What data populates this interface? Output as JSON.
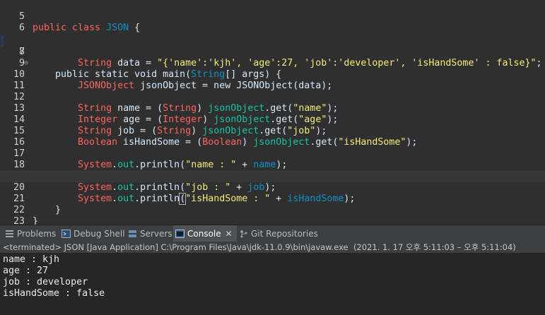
{
  "editor": {
    "lines": [
      {
        "n": "5",
        "text": "public class JSON {"
      },
      {
        "n": "6",
        "text": ""
      },
      {
        "n": "7",
        "text": "    public static void main(String[] args) {"
      },
      {
        "n": "8",
        "text": "        String data = \"{'name':'kjh', 'age':27, 'job':'developer', 'isHandSome' : false}\";"
      },
      {
        "n": "9",
        "text": ""
      },
      {
        "n": "10",
        "text": "        JSONObject jsonObject = new JSONObject(data);"
      },
      {
        "n": "11",
        "text": ""
      },
      {
        "n": "12",
        "text": "        String name = (String) jsonObject.get(\"name\");"
      },
      {
        "n": "13",
        "text": "        Integer age = (Integer) jsonObject.get(\"age\");"
      },
      {
        "n": "14",
        "text": "        String job = (String) jsonObject.get(\"job\");"
      },
      {
        "n": "15",
        "text": "        Boolean isHandSome = (Boolean) jsonObject.get(\"isHandSome\");"
      },
      {
        "n": "16",
        "text": ""
      },
      {
        "n": "17",
        "text": "        System.out.println(\"name : \" + name);"
      },
      {
        "n": "18",
        "text": "        System.out.println(\"age : \" + age);"
      },
      {
        "n": "19",
        "text": "        System.out.println(\"job : \" + job);"
      },
      {
        "n": "20",
        "text": "        System.out.println(\"isHandSome : \" + isHandSome);"
      },
      {
        "n": "21",
        "text": "    }"
      },
      {
        "n": "22",
        "text": "}"
      },
      {
        "n": "23",
        "text": ""
      }
    ],
    "active_line": "20"
  },
  "tabs": [
    {
      "label": "Problems",
      "icon": "problems-icon"
    },
    {
      "label": "Debug Shell",
      "icon": "debug-shell-icon"
    },
    {
      "label": "Servers",
      "icon": "servers-icon"
    },
    {
      "label": "Console",
      "icon": "console-icon",
      "close": "✕"
    },
    {
      "label": "Git Repositories",
      "icon": "git-repositories-icon"
    }
  ],
  "console": {
    "header": "<terminated> JSON [Java Application] C:\\Program Files\\Java\\jdk-11.0.9\\bin\\javaw.exe  (2021. 1. 17 오후 5:11:03 – 오후 5:11:04)",
    "output": [
      "name : kjh",
      "age : 27",
      "job : developer",
      "isHandSome : false"
    ]
  },
  "colors": {
    "background": "#2f2f2f",
    "console_bg": "#262626",
    "string": "#17c6a3",
    "type": "#1290c3"
  }
}
